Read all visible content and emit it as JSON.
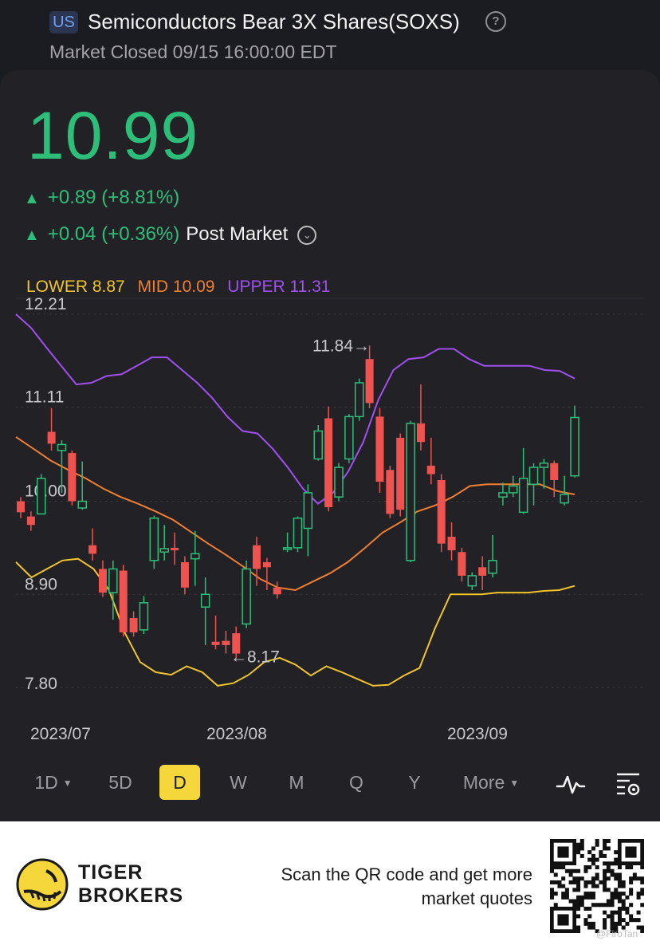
{
  "header": {
    "market_badge": "US",
    "title": "Semiconductors Bear 3X Shares(SOXS)",
    "help_icon": "question-circle-icon",
    "status": "Market Closed 09/15 16:00:00 EDT"
  },
  "quote": {
    "price": "10.99",
    "change": "+0.89 (+8.81%)",
    "post_change": "+0.04 (+0.36%)",
    "post_label": "Post Market",
    "up_icon": "triangle-up-icon",
    "up_color": "#2dbf79"
  },
  "indicator": {
    "lower_label": "LOWER 8.87",
    "mid_label": "MID 10.09",
    "upper_label": "UPPER 11.31",
    "lower_color": "#f0c42a",
    "mid_color": "#f07f2f",
    "upper_color": "#a050f0"
  },
  "chart_data": {
    "type": "candlestick",
    "y_ticks": [
      "12.21",
      "11.11",
      "10.00",
      "8.90",
      "7.80"
    ],
    "ylim": [
      7.8,
      12.21
    ],
    "x_ticks": [
      "2023/07",
      "2023/08",
      "2023/09"
    ],
    "annotations": {
      "high": "11.84",
      "low": "8.17"
    },
    "up_color": "#2dbf79",
    "down_color": "#ef5350",
    "candles": [
      {
        "o": 10.0,
        "c": 9.87,
        "h": 10.05,
        "l": 9.8
      },
      {
        "o": 9.82,
        "c": 9.72,
        "h": 9.88,
        "l": 9.65
      },
      {
        "o": 9.85,
        "c": 10.27,
        "h": 10.32,
        "l": 9.85
      },
      {
        "o": 10.82,
        "c": 10.68,
        "h": 11.1,
        "l": 10.6
      },
      {
        "o": 10.6,
        "c": 10.67,
        "h": 10.72,
        "l": 10.1
      },
      {
        "o": 10.57,
        "c": 10.0,
        "h": 10.6,
        "l": 9.95
      },
      {
        "o": 9.92,
        "c": 10.0,
        "h": 10.47,
        "l": 9.9
      },
      {
        "o": 9.48,
        "c": 9.38,
        "h": 9.68,
        "l": 9.3
      },
      {
        "o": 9.2,
        "c": 8.92,
        "h": 9.3,
        "l": 8.87
      },
      {
        "o": 8.92,
        "c": 9.2,
        "h": 9.3,
        "l": 8.6
      },
      {
        "o": 9.18,
        "c": 8.45,
        "h": 9.25,
        "l": 8.4
      },
      {
        "o": 8.62,
        "c": 8.45,
        "h": 8.7,
        "l": 8.4
      },
      {
        "o": 8.48,
        "c": 8.8,
        "h": 8.88,
        "l": 8.43
      },
      {
        "o": 9.3,
        "c": 9.8,
        "h": 9.83,
        "l": 9.2
      },
      {
        "o": 9.4,
        "c": 9.44,
        "h": 9.72,
        "l": 9.3
      },
      {
        "o": 9.45,
        "c": 9.42,
        "h": 9.63,
        "l": 9.25
      },
      {
        "o": 9.28,
        "c": 8.98,
        "h": 9.35,
        "l": 8.9
      },
      {
        "o": 9.32,
        "c": 9.38,
        "h": 9.65,
        "l": 9.0
      },
      {
        "o": 8.75,
        "c": 8.9,
        "h": 9.1,
        "l": 8.3
      },
      {
        "o": 8.34,
        "c": 8.3,
        "h": 8.65,
        "l": 8.25
      },
      {
        "o": 8.35,
        "c": 8.3,
        "h": 8.47,
        "l": 8.2
      },
      {
        "o": 8.44,
        "c": 8.2,
        "h": 8.52,
        "l": 8.15
      },
      {
        "o": 8.55,
        "c": 9.2,
        "h": 9.3,
        "l": 8.5
      },
      {
        "o": 9.48,
        "c": 9.2,
        "h": 9.58,
        "l": 9.0
      },
      {
        "o": 9.28,
        "c": 9.22,
        "h": 9.33,
        "l": 8.95
      },
      {
        "o": 8.98,
        "c": 8.9,
        "h": 9.05,
        "l": 8.85
      },
      {
        "o": 9.44,
        "c": 9.45,
        "h": 9.63,
        "l": 9.4
      },
      {
        "o": 9.45,
        "c": 9.8,
        "h": 9.82,
        "l": 9.4
      },
      {
        "o": 9.68,
        "c": 10.1,
        "h": 10.2,
        "l": 9.35
      },
      {
        "o": 10.5,
        "c": 10.83,
        "h": 10.9,
        "l": 10.48
      },
      {
        "o": 10.98,
        "c": 9.93,
        "h": 11.12,
        "l": 9.88
      },
      {
        "o": 10.05,
        "c": 10.4,
        "h": 10.45,
        "l": 10.0
      },
      {
        "o": 10.5,
        "c": 11.0,
        "h": 11.03,
        "l": 10.45
      },
      {
        "o": 11.0,
        "c": 11.4,
        "h": 11.45,
        "l": 10.95
      },
      {
        "o": 11.68,
        "c": 11.16,
        "h": 11.84,
        "l": 11.1
      },
      {
        "o": 11.0,
        "c": 10.23,
        "h": 11.1,
        "l": 10.1
      },
      {
        "o": 10.37,
        "c": 9.85,
        "h": 10.42,
        "l": 9.8
      },
      {
        "o": 10.75,
        "c": 9.9,
        "h": 10.8,
        "l": 9.82
      },
      {
        "o": 9.3,
        "c": 10.92,
        "h": 10.95,
        "l": 9.28
      },
      {
        "o": 10.92,
        "c": 10.7,
        "h": 11.38,
        "l": 10.6
      },
      {
        "o": 10.42,
        "c": 10.32,
        "h": 10.75,
        "l": 10.2
      },
      {
        "o": 10.25,
        "c": 9.5,
        "h": 10.32,
        "l": 9.4
      },
      {
        "o": 9.58,
        "c": 9.42,
        "h": 9.75,
        "l": 9.3
      },
      {
        "o": 9.4,
        "c": 9.12,
        "h": 9.45,
        "l": 9.05
      },
      {
        "o": 9.0,
        "c": 9.12,
        "h": 9.16,
        "l": 8.95
      },
      {
        "o": 9.22,
        "c": 9.12,
        "h": 9.35,
        "l": 8.95
      },
      {
        "o": 9.15,
        "c": 9.3,
        "h": 9.6,
        "l": 9.1
      },
      {
        "o": 10.05,
        "c": 10.1,
        "h": 10.22,
        "l": 9.95
      },
      {
        "o": 10.1,
        "c": 10.18,
        "h": 10.3,
        "l": 10.05
      },
      {
        "o": 9.87,
        "c": 10.27,
        "h": 10.63,
        "l": 9.85
      },
      {
        "o": 10.2,
        "c": 10.4,
        "h": 10.45,
        "l": 9.95
      },
      {
        "o": 10.4,
        "c": 10.45,
        "h": 10.5,
        "l": 10.15
      },
      {
        "o": 10.45,
        "c": 10.25,
        "h": 10.48,
        "l": 10.05
      },
      {
        "o": 9.98,
        "c": 10.08,
        "h": 10.3,
        "l": 9.95
      },
      {
        "o": 10.3,
        "c": 10.99,
        "h": 11.13,
        "l": 10.28
      }
    ],
    "upper_band": [
      12.21,
      12.05,
      11.82,
      11.6,
      11.38,
      11.4,
      11.48,
      11.5,
      11.6,
      11.7,
      11.7,
      11.55,
      11.4,
      11.22,
      11.0,
      10.83,
      10.8,
      10.62,
      10.4,
      10.15,
      9.97,
      10.1,
      10.35,
      10.7,
      11.2,
      11.55,
      11.68,
      11.7,
      11.8,
      11.8,
      11.68,
      11.6,
      11.6,
      11.6,
      11.6,
      11.55,
      11.54,
      11.45
    ],
    "mid_band": [
      10.76,
      10.62,
      10.48,
      10.37,
      10.27,
      10.15,
      10.05,
      9.97,
      9.88,
      9.78,
      9.64,
      9.5,
      9.37,
      9.23,
      9.08,
      8.98,
      8.95,
      9.05,
      9.15,
      9.28,
      9.45,
      9.63,
      9.75,
      9.88,
      9.95,
      10.05,
      10.18,
      10.2,
      10.2,
      10.2,
      10.2,
      10.12,
      10.08
    ],
    "lower_band": [
      9.28,
      9.1,
      9.2,
      9.3,
      9.32,
      9.2,
      8.95,
      8.45,
      8.1,
      7.98,
      7.95,
      8.05,
      7.98,
      7.82,
      7.85,
      7.95,
      8.1,
      8.15,
      8.07,
      7.94,
      8.05,
      7.98,
      7.9,
      7.82,
      7.83,
      7.94,
      8.03,
      8.5,
      8.9,
      8.9,
      8.9,
      8.92,
      8.92,
      8.92,
      8.94,
      8.95,
      9.0
    ]
  },
  "periods": [
    {
      "label": "1D",
      "dropdown": true,
      "active": false
    },
    {
      "label": "5D",
      "dropdown": false,
      "active": false
    },
    {
      "label": "D",
      "dropdown": false,
      "active": true
    },
    {
      "label": "W",
      "dropdown": false,
      "active": false
    },
    {
      "label": "M",
      "dropdown": false,
      "active": false
    },
    {
      "label": "Q",
      "dropdown": false,
      "active": false
    },
    {
      "label": "Y",
      "dropdown": false,
      "active": false
    },
    {
      "label": "More",
      "dropdown": true,
      "active": false
    }
  ],
  "toolbar_icons": {
    "indicator": "pulse-line-icon",
    "settings": "chart-settings-icon"
  },
  "footer": {
    "brand_line1": "TIGER",
    "brand_line2": "BROKERS",
    "scan_line1": "Scan the QR code and get more",
    "scan_line2": "market quotes",
    "watermark": "@FiroTan"
  }
}
